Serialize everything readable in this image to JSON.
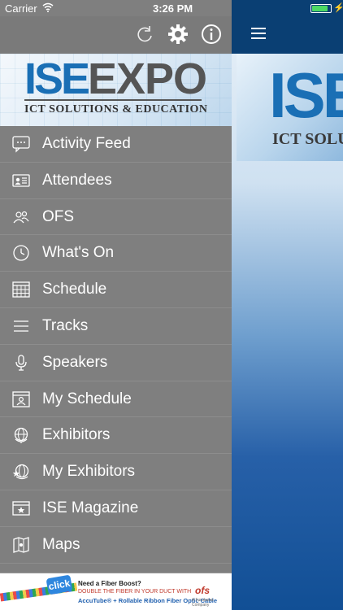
{
  "status_bar": {
    "carrier": "Carrier",
    "time": "3:26 PM",
    "battery_level": 0.85
  },
  "drawer": {
    "toolbar_icons": [
      "refresh-icon",
      "gear-icon",
      "info-icon"
    ],
    "logo": {
      "ise": "ISE",
      "expo": "EXPO",
      "tagline": "ICT SOLUTIONS & EDUCATION"
    },
    "menu": [
      {
        "label": "Activity Feed",
        "icon": "chat-bubble-icon"
      },
      {
        "label": "Attendees",
        "icon": "id-card-icon"
      },
      {
        "label": "OFS",
        "icon": "people-icon"
      },
      {
        "label": "What's On",
        "icon": "clock-icon"
      },
      {
        "label": "Schedule",
        "icon": "calendar-grid-icon"
      },
      {
        "label": "Tracks",
        "icon": "list-lines-icon"
      },
      {
        "label": "Speakers",
        "icon": "microphone-icon"
      },
      {
        "label": "My Schedule",
        "icon": "person-calendar-icon"
      },
      {
        "label": "Exhibitors",
        "icon": "globe-icon"
      },
      {
        "label": "My Exhibitors",
        "icon": "star-globe-icon"
      },
      {
        "label": "ISE Magazine",
        "icon": "magazine-icon"
      },
      {
        "label": "Maps",
        "icon": "map-icon"
      }
    ],
    "ad": {
      "click": "click",
      "line1": "Need a Fiber Boost?",
      "line2": "DOUBLE THE FIBER IN YOUR DUCT WITH",
      "line3": "AccuTube® + Rollable Ribbon Fiber Optic Cable",
      "brand": "ofs",
      "brand_sub": "A Furukawa Company"
    }
  },
  "content": {
    "banner": {
      "ise": "ISE",
      "tagline": "ICT SOLUTIONS & EDUCATION"
    }
  },
  "colors": {
    "drawer_bg": "#7f7f7f",
    "brand_blue": "#1a6fb5",
    "topbar": "#0a3f73",
    "battery": "#4cd964"
  }
}
